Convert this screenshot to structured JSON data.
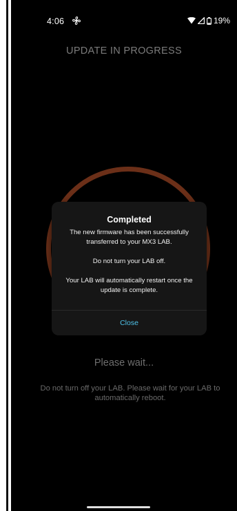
{
  "status_bar": {
    "time": "4:06",
    "battery_percent": "19%",
    "icons": [
      "fan-icon",
      "wifi-icon",
      "signal-icon",
      "battery-icon"
    ]
  },
  "header": {
    "title": "UPDATE IN PROGRESS"
  },
  "progress_ring": {
    "color": "#6b2f18"
  },
  "dialog": {
    "title": "Completed",
    "line1": "The new firmware has been successfully transferred to your MX3 LAB.",
    "line2": "Do not turn your LAB off.",
    "line3": "Your LAB will automatically restart once the update is complete.",
    "close_label": "Close",
    "accent_color": "#4fc2e8"
  },
  "main": {
    "please_wait": "Please wait...",
    "info": "Do not turn off your LAB. Please wait for your LAB to automatically reboot."
  }
}
